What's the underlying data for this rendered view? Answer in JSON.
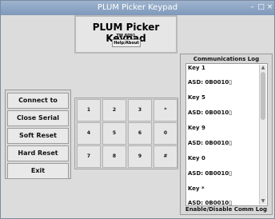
{
  "window": {
    "title": "PLUM Picker Keypad",
    "controls": {
      "minimize": "–",
      "maximize": "□",
      "close": "×"
    }
  },
  "header": {
    "title": "PLUM Picker Keypad",
    "subtitle": "TM 8091",
    "help_label": "Help/About"
  },
  "commands": {
    "connect": "Connect to Serial",
    "close": "Close Serial Comm",
    "soft_reset": "Soft Reset",
    "hard_reset": "Hard Reset",
    "exit": "Exit"
  },
  "keypad": {
    "keys": [
      "1",
      "2",
      "3",
      "*",
      "4",
      "5",
      "6",
      "0",
      "7",
      "8",
      "9",
      "#"
    ]
  },
  "comm_log": {
    "title": "Communications Log",
    "entries": [
      "Key 1",
      "ASD: 0B0010▯",
      "Key 5",
      "ASD: 0B0010▯",
      "Key 9",
      "ASD: 0B0010▯",
      "Key 0",
      "ASD: 0B0010▯",
      "Key *",
      "ASD: 0B0010▯"
    ],
    "toggle_label": "Enable/Disable Comm Log"
  }
}
